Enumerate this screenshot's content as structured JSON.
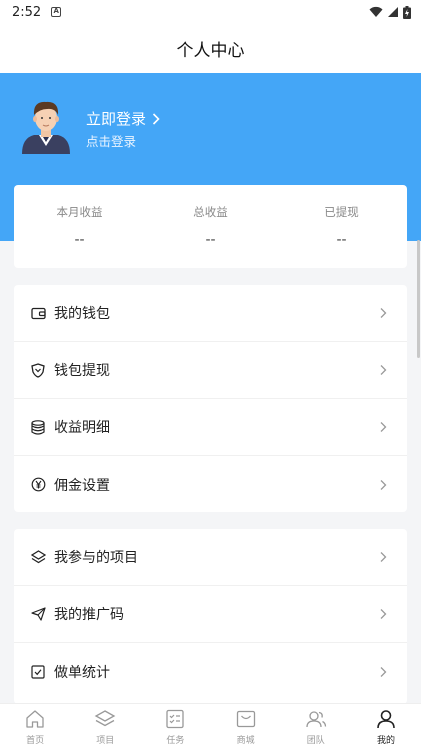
{
  "status_bar": {
    "time": "2:52",
    "notification_icon": "A"
  },
  "header": {
    "title": "个人中心"
  },
  "profile": {
    "login_title": "立即登录",
    "login_subtitle": "点击登录"
  },
  "stats": [
    {
      "label": "本月收益",
      "value": "--"
    },
    {
      "label": "总收益",
      "value": "--"
    },
    {
      "label": "已提现",
      "value": "--"
    }
  ],
  "menu_group_1": [
    {
      "label": "我的钱包",
      "icon": "wallet-icon"
    },
    {
      "label": "钱包提现",
      "icon": "shield-icon"
    },
    {
      "label": "收益明细",
      "icon": "database-icon"
    },
    {
      "label": "佣金设置",
      "icon": "yen-icon"
    }
  ],
  "menu_group_2": [
    {
      "label": "我参与的项目",
      "icon": "layers-icon"
    },
    {
      "label": "我的推广码",
      "icon": "send-icon"
    },
    {
      "label": "做单统计",
      "icon": "checkbox-icon"
    }
  ],
  "tabbar": [
    {
      "label": "首页",
      "icon": "home-icon"
    },
    {
      "label": "项目",
      "icon": "layers-icon"
    },
    {
      "label": "任务",
      "icon": "task-list-icon"
    },
    {
      "label": "商城",
      "icon": "mall-icon"
    },
    {
      "label": "团队",
      "icon": "team-icon"
    },
    {
      "label": "我的",
      "icon": "user-icon",
      "active": true
    }
  ]
}
